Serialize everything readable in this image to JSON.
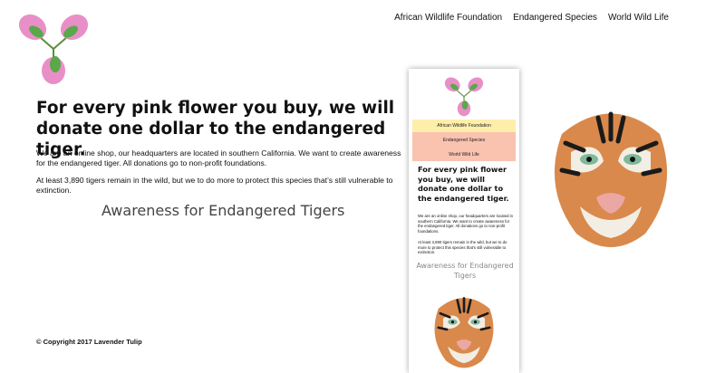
{
  "nav": {
    "items": [
      {
        "label": "African Wildlife Foundation"
      },
      {
        "label": "Endangered Species"
      },
      {
        "label": "World Wild Life"
      }
    ]
  },
  "main": {
    "headline": "For every pink flower you buy, we will donate one dollar to the endangered tiger.",
    "paragraph1": "We are an online shop, our headquarters are located in southern California. We want to create awareness for the endangered tiger. All donations go to non-profit foundations.",
    "paragraph2": "At least 3,890 tigers remain in the wild, but we to do more to protect this species that’s still vulnerable to extinction.",
    "subtitle": "Awareness for Endangered Tigers"
  },
  "mobile": {
    "nav": [
      {
        "label": "African Wildlife Foundation"
      },
      {
        "label": "Endangered Species"
      },
      {
        "label": "World Wild Life"
      }
    ],
    "headline": "For every pink flower you buy, we will donate one dollar to the endangered tiger.",
    "paragraph1": "We are an online shop, our headquarters are located in southern California. We want to create awareness for the endangered tiger. All donations go to non-profit foundations.",
    "paragraph2": "At least 3,890 tigers remain in the wild, but we to do more to protect this species that’s still vulnerable to extinction.",
    "subtitle": "Awareness for Endangered Tigers"
  },
  "footer": {
    "copyright": "© Copyright 2017 Lavender Tulip"
  },
  "images": {
    "logo": "pink-flower-logo",
    "tiger": "tiger-face-illustration"
  },
  "colors": {
    "mobile_nav_1": "#fdeeaa",
    "mobile_nav_2": "#f9c3b0",
    "flower_pink": "#e98fc7",
    "leaf_green": "#4f9a3a"
  }
}
